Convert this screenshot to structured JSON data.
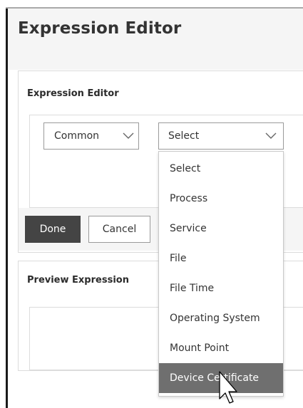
{
  "page": {
    "title": "Expression Editor"
  },
  "editor": {
    "title": "Expression Editor",
    "common_dropdown": {
      "value": "Common"
    },
    "select_dropdown": {
      "value": "Select"
    },
    "options": [
      "Select",
      "Process",
      "Service",
      "File",
      "File Time",
      "Operating System",
      "Mount Point",
      "Device Certificate"
    ],
    "highlighted_option": "Device Certificate"
  },
  "actions": {
    "done": "Done",
    "cancel": "Cancel"
  },
  "preview": {
    "title": "Preview Expression",
    "expression": ""
  },
  "colors": {
    "primary_button": "#444444",
    "highlight": "#6f6f6f",
    "header_bg": "#f5f5f5",
    "border": "#dcdcdc"
  },
  "icons": {
    "dropdown": "chevron-down-icon",
    "cursor": "mouse-pointer-icon"
  }
}
